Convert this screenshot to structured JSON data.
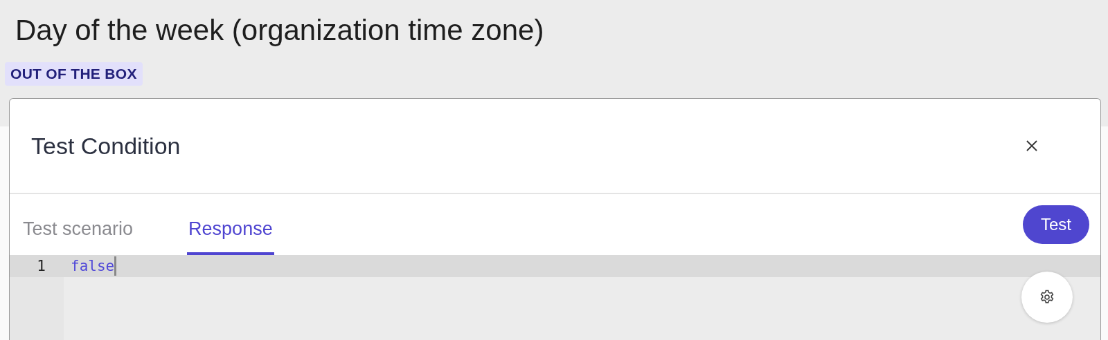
{
  "page": {
    "title": "Day of the week (organization time zone)",
    "badge": "OUT OF THE BOX"
  },
  "dialog": {
    "title": "Test Condition",
    "tabs": [
      {
        "label": "Test scenario",
        "selected": false
      },
      {
        "label": "Response",
        "selected": true
      }
    ],
    "test_button": "Test",
    "editor": {
      "lines": [
        {
          "number": "1",
          "text": "false",
          "selected": true
        }
      ]
    }
  }
}
